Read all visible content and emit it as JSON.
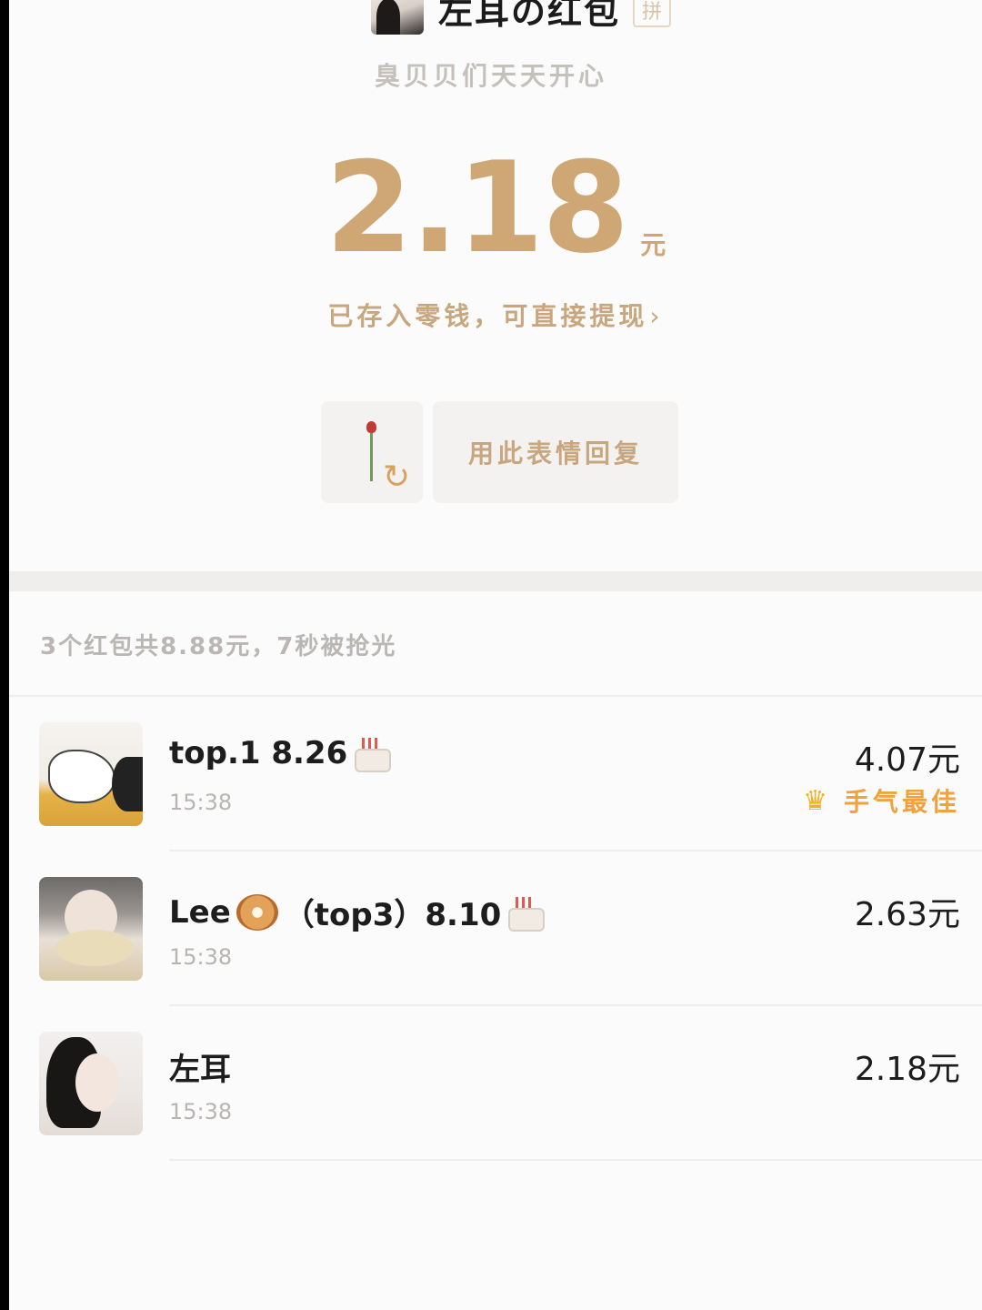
{
  "header": {
    "sender_name": "左耳の红包",
    "pin_badge": "拼",
    "greeting": "臭贝贝们天天开心"
  },
  "received": {
    "amount": "2.18",
    "unit": "元",
    "saved_text": "已存入零钱，可直接提现",
    "chevron": "›"
  },
  "actions": {
    "sticker_icon": "rose-sticker-icon",
    "refresh_glyph": "↻",
    "reply_label": "用此表情回复"
  },
  "summary": "3个红包共8.88元，7秒被抢光",
  "claims": [
    {
      "name_text": "top.1  8.26",
      "emoji": "cake-icon",
      "time": "15:38",
      "amount": "4.07元",
      "best_luck": "手气最佳",
      "crown_glyph": "♛"
    },
    {
      "name_prefix": "Lee",
      "emoji_mid": "bagel-icon",
      "name_suffix": "（top3）8.10",
      "emoji": "cake-icon",
      "time": "15:38",
      "amount": "2.63元"
    },
    {
      "name_text": "左耳",
      "time": "15:38",
      "amount": "2.18元"
    }
  ],
  "colors": {
    "gold": "#cfa774",
    "best_luck": "#f0a23c"
  }
}
